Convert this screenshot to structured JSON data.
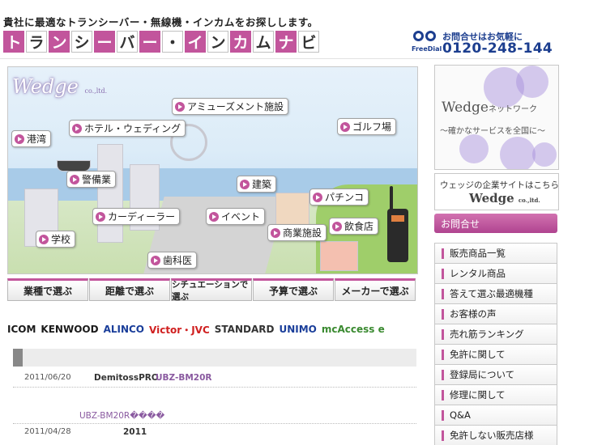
{
  "header": {
    "tagline": "貴社に最適なトランシーバー・無線機・インカムをお探しします。",
    "title_chars": [
      "ト",
      "ラ",
      "ン",
      "シ",
      "ー",
      "バ",
      "ー",
      "・",
      "イ",
      "ン",
      "カ",
      "ム",
      "ナ",
      "ビ"
    ],
    "title_pink_indices": [
      0,
      2,
      4,
      6,
      8,
      10,
      12
    ],
    "freedial_label": "FreeDial",
    "contact_label": "お問合せはお気軽に",
    "phone": "0120-248-144"
  },
  "hero": {
    "logo": "Wedge",
    "logo_suffix": "co.,ltd.",
    "labels": {
      "harbor": "港湾",
      "hotel": "ホテル・ウェディング",
      "amusement": "アミューズメント施設",
      "golf": "ゴルフ場",
      "security": "警備業",
      "construction": "建築",
      "pachinko": "パチンコ",
      "dealer": "カーディーラー",
      "event": "イベント",
      "restaurant": "飲食店",
      "school": "学校",
      "commercial": "商業施設",
      "dentist": "歯科医"
    }
  },
  "nav": [
    "業種で選ぶ",
    "距離で選ぶ",
    "シチュエーションで選ぶ",
    "予算で選ぶ",
    "メーカーで選ぶ"
  ],
  "makers": [
    {
      "name": "ICOM",
      "color": "#1a1a1a"
    },
    {
      "name": "KENWOOD",
      "color": "#1a1a1a"
    },
    {
      "name": "ALINCO",
      "color": "#1a3e9a"
    },
    {
      "name": "Victor・JVC",
      "color": "#d02020"
    },
    {
      "name": "STANDARD",
      "color": "#333333"
    },
    {
      "name": "UNIMO",
      "color": "#1a3e9a"
    },
    {
      "name": "mcAccess e",
      "color": "#3a8a30"
    }
  ],
  "news": [
    {
      "date": "2011/06/20",
      "title": "DemitossPRO",
      "link": "UBZ-BM20R"
    },
    {
      "date": "",
      "title": "",
      "link": "UBZ-BM20R����"
    },
    {
      "date": "2011/04/28",
      "title": "2011",
      "link": ""
    }
  ],
  "sidebar": {
    "network_title": "Wedge",
    "network_suffix": "ネットワーク",
    "network_sub": "～確かなサービスを全国に～",
    "corp_text": "ウェッジの企業サイトはこちら",
    "corp_logo": "Wedge",
    "corp_logo_suffix": "co.,ltd.",
    "contact": "お問合せ",
    "menu": [
      "販売商品一覧",
      "レンタル商品",
      "答えて選ぶ最適機種",
      "お客様の声",
      "売れ筋ランキング",
      "免許に関して",
      "登録局について",
      "修理に関して",
      "Q&A",
      "免許しない販売店様"
    ]
  },
  "colors": {
    "accent": "#c2559c",
    "brand_blue": "#1c3e8f"
  }
}
